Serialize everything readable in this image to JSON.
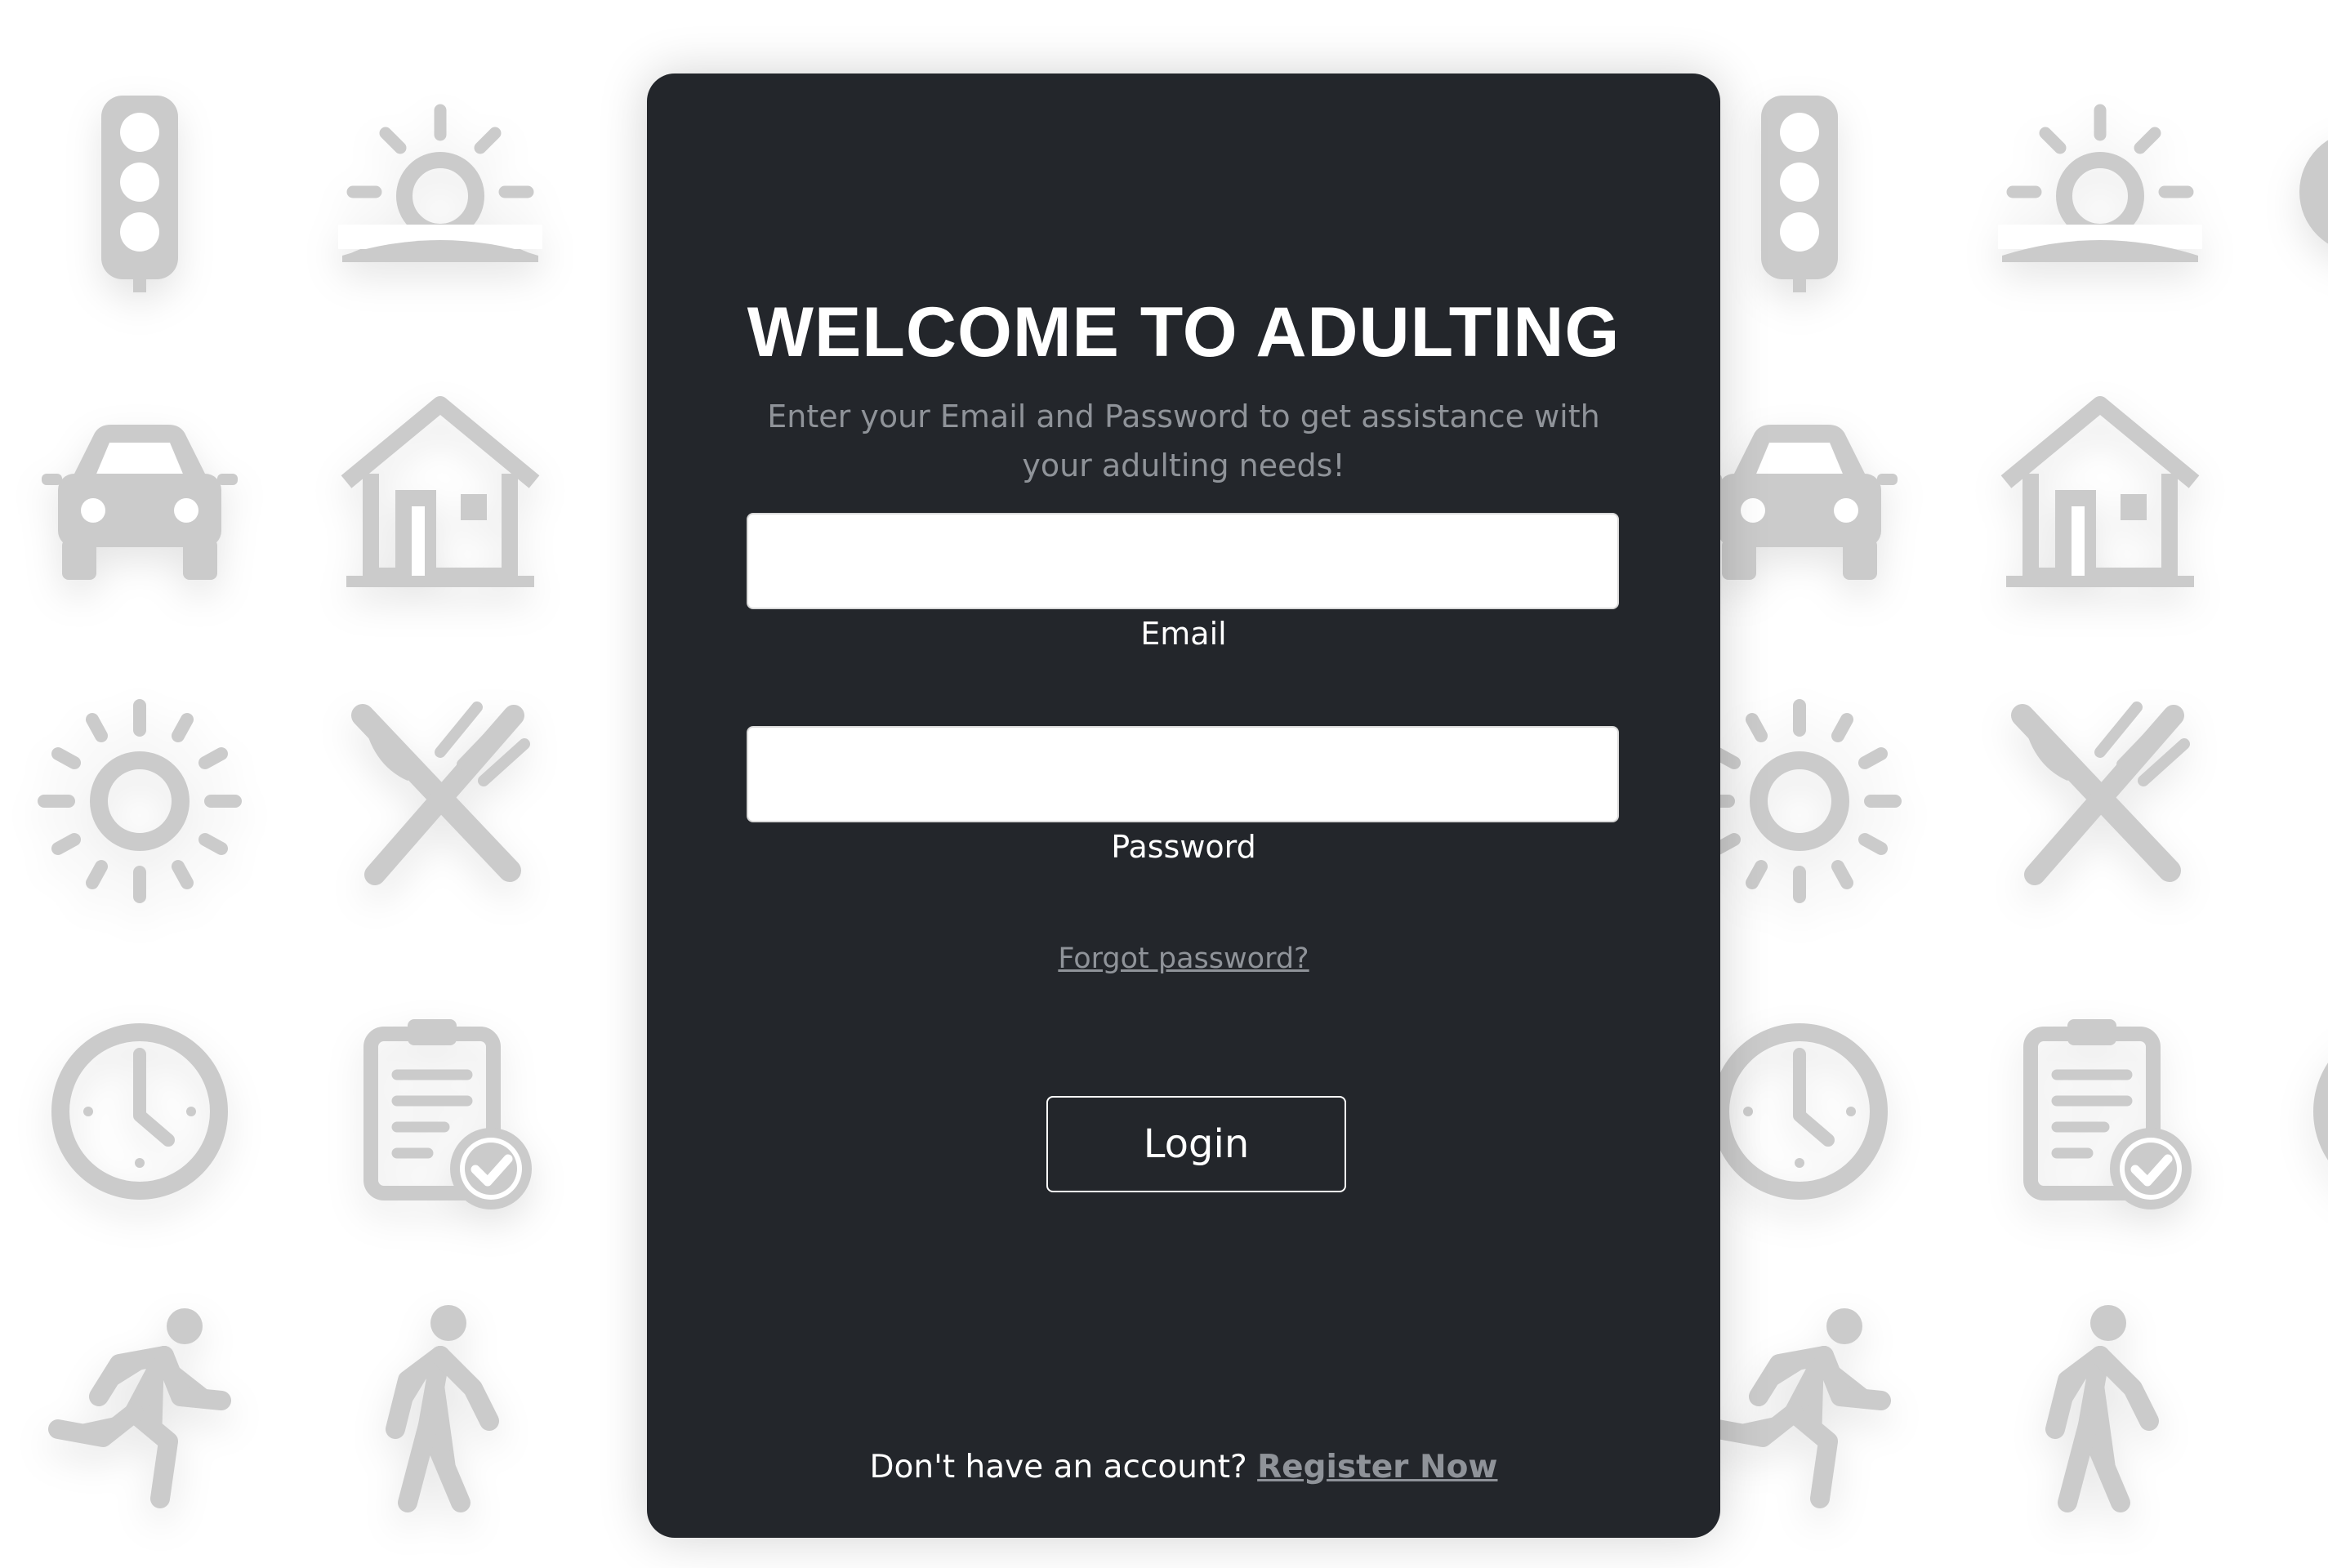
{
  "login": {
    "title": "WELCOME TO ADULTING",
    "subtitle": "Enter your Email and Password to get assistance with your adulting needs!",
    "email_label": "Email",
    "email_value": "",
    "password_label": "Password",
    "password_value": "",
    "forgot_link": "Forgot password?",
    "login_button": "Login",
    "register_prompt": "Don't have an account?",
    "register_link": "Register Now"
  },
  "background_icons": [
    "traffic-light-icon",
    "sunrise-icon",
    "car-icon",
    "house-icon",
    "sun-icon",
    "fork-knife-icon",
    "clock-icon",
    "clipboard-check-icon",
    "running-person-icon",
    "walking-person-icon"
  ],
  "colors": {
    "card_background": "#23262b",
    "icon_gray": "#cbcbcb",
    "muted_text": "#8f9399",
    "page_background": "#ffffff"
  }
}
